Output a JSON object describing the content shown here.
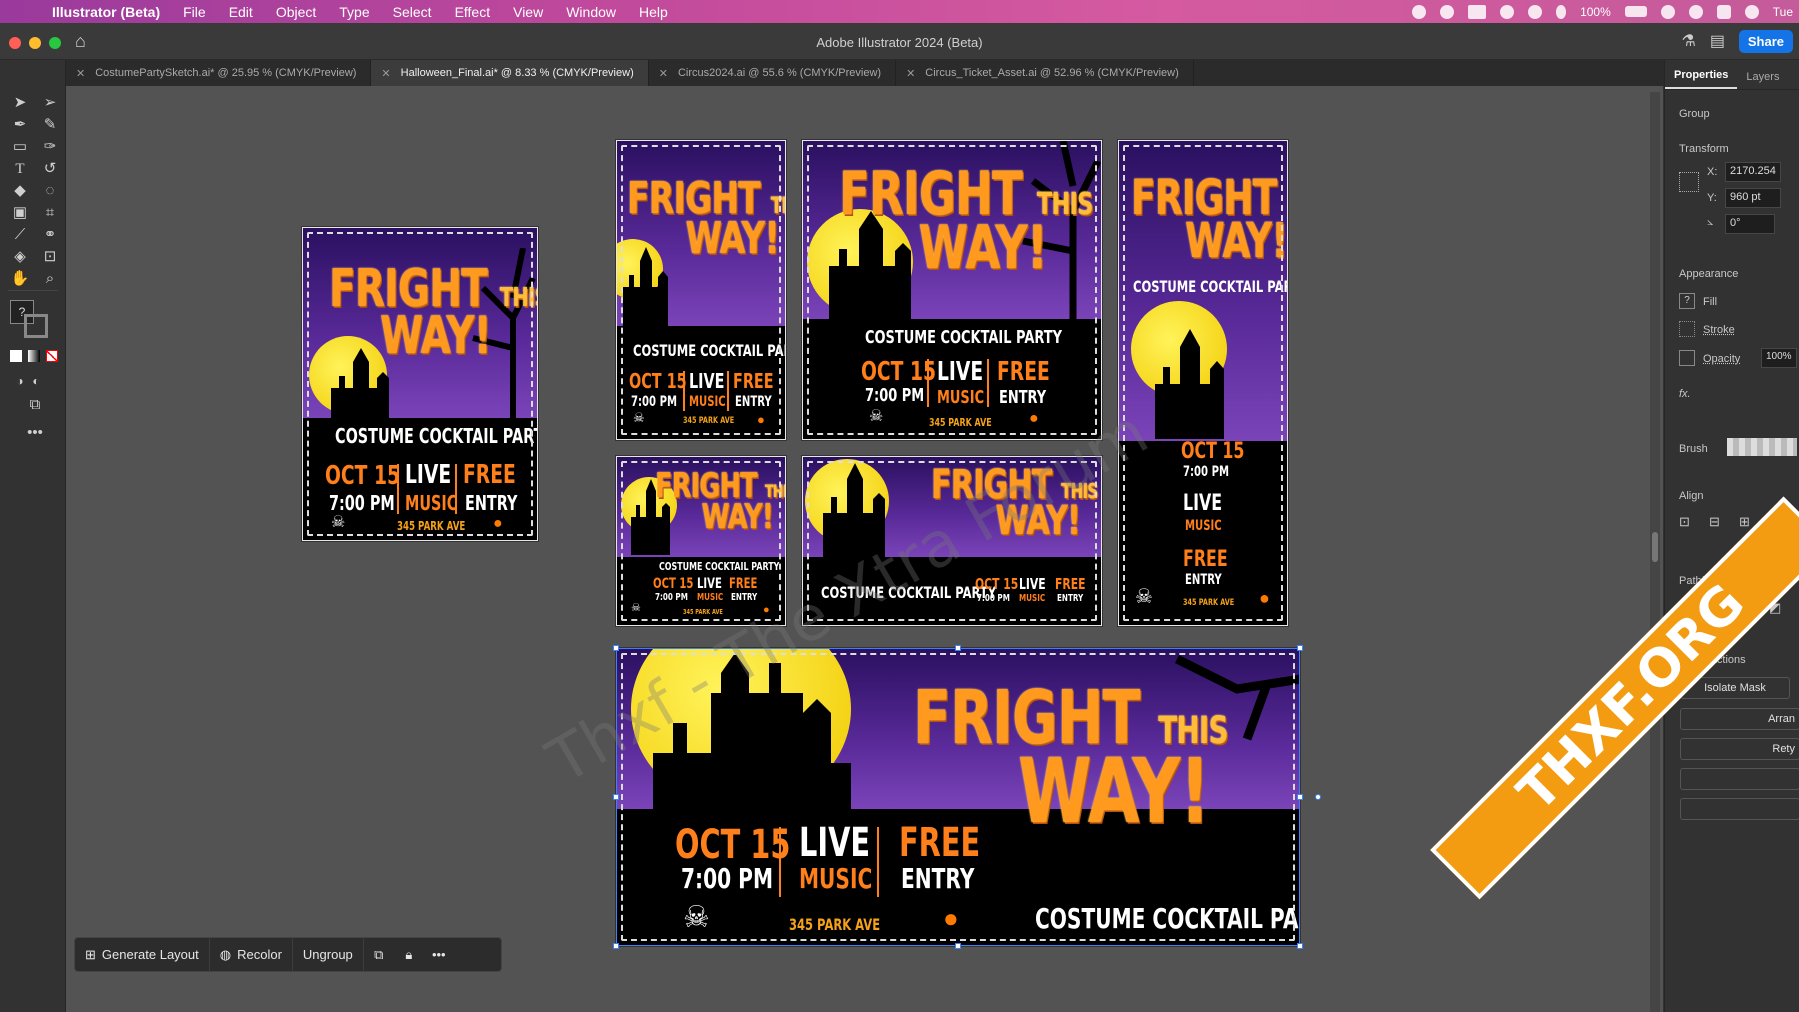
{
  "menubar": {
    "app_name": "Illustrator (Beta)",
    "items": [
      "File",
      "Edit",
      "Object",
      "Type",
      "Select",
      "Effect",
      "View",
      "Window",
      "Help"
    ],
    "battery": "100%",
    "clock": "Tue"
  },
  "window": {
    "title": "Adobe Illustrator 2024 (Beta)",
    "share_label": "Share"
  },
  "tabs": [
    {
      "label": "CostumePartySketch.ai* @ 25.95 % (CMYK/Preview)",
      "active": false
    },
    {
      "label": "Halloween_Final.ai* @ 8.33 % (CMYK/Preview)",
      "active": true
    },
    {
      "label": "Circus2024.ai @ 55.6 % (CMYK/Preview)",
      "active": false
    },
    {
      "label": "Circus_Ticket_Asset.ai @ 52.96 % (CMYK/Preview)",
      "active": false
    }
  ],
  "panel": {
    "tabs": [
      "Properties",
      "Layers"
    ],
    "group_label": "Group",
    "transform_label": "Transform",
    "x_label": "X:",
    "x_value": "2170.254",
    "y_label": "Y:",
    "y_value": "960 pt",
    "angle_value": "0°",
    "appearance_label": "Appearance",
    "fill_label": "Fill",
    "stroke_label": "Stroke",
    "opacity_label": "Opacity",
    "opacity_value": "100%",
    "fx_label": "fx.",
    "brush_label": "Brush",
    "align_label": "Align",
    "pathfinder_label": "Pathfinder",
    "quick_actions_label": "Quick Actions",
    "isolate_mask_label": "Isolate Mask",
    "arrange_label": "Arran",
    "retype_label": "Rety"
  },
  "poster": {
    "headline_1": "FRIGHT",
    "headline_this": "THIS",
    "headline_2": "WAY!",
    "subtitle": "COSTUME COCKTAIL PARTY",
    "date": "OCT 15",
    "time": "7:00 PM",
    "live": "LIVE",
    "music": "MUSIC",
    "free": "FREE",
    "entry": "ENTRY",
    "address": "345 PARK AVE"
  },
  "context_bar": {
    "generate_layout": "Generate Layout",
    "recolor": "Recolor",
    "ungroup": "Ungroup"
  },
  "watermark": "Thxf - The Xtra Forum",
  "ribbon_text": "THXF.ORG",
  "colors": {
    "accent": "#1473e6",
    "poster_orange": "#ff7f1a",
    "poster_purple": "#5a2a9a",
    "moon_yellow": "#f1c900",
    "selection_blue": "#3b82f6"
  }
}
